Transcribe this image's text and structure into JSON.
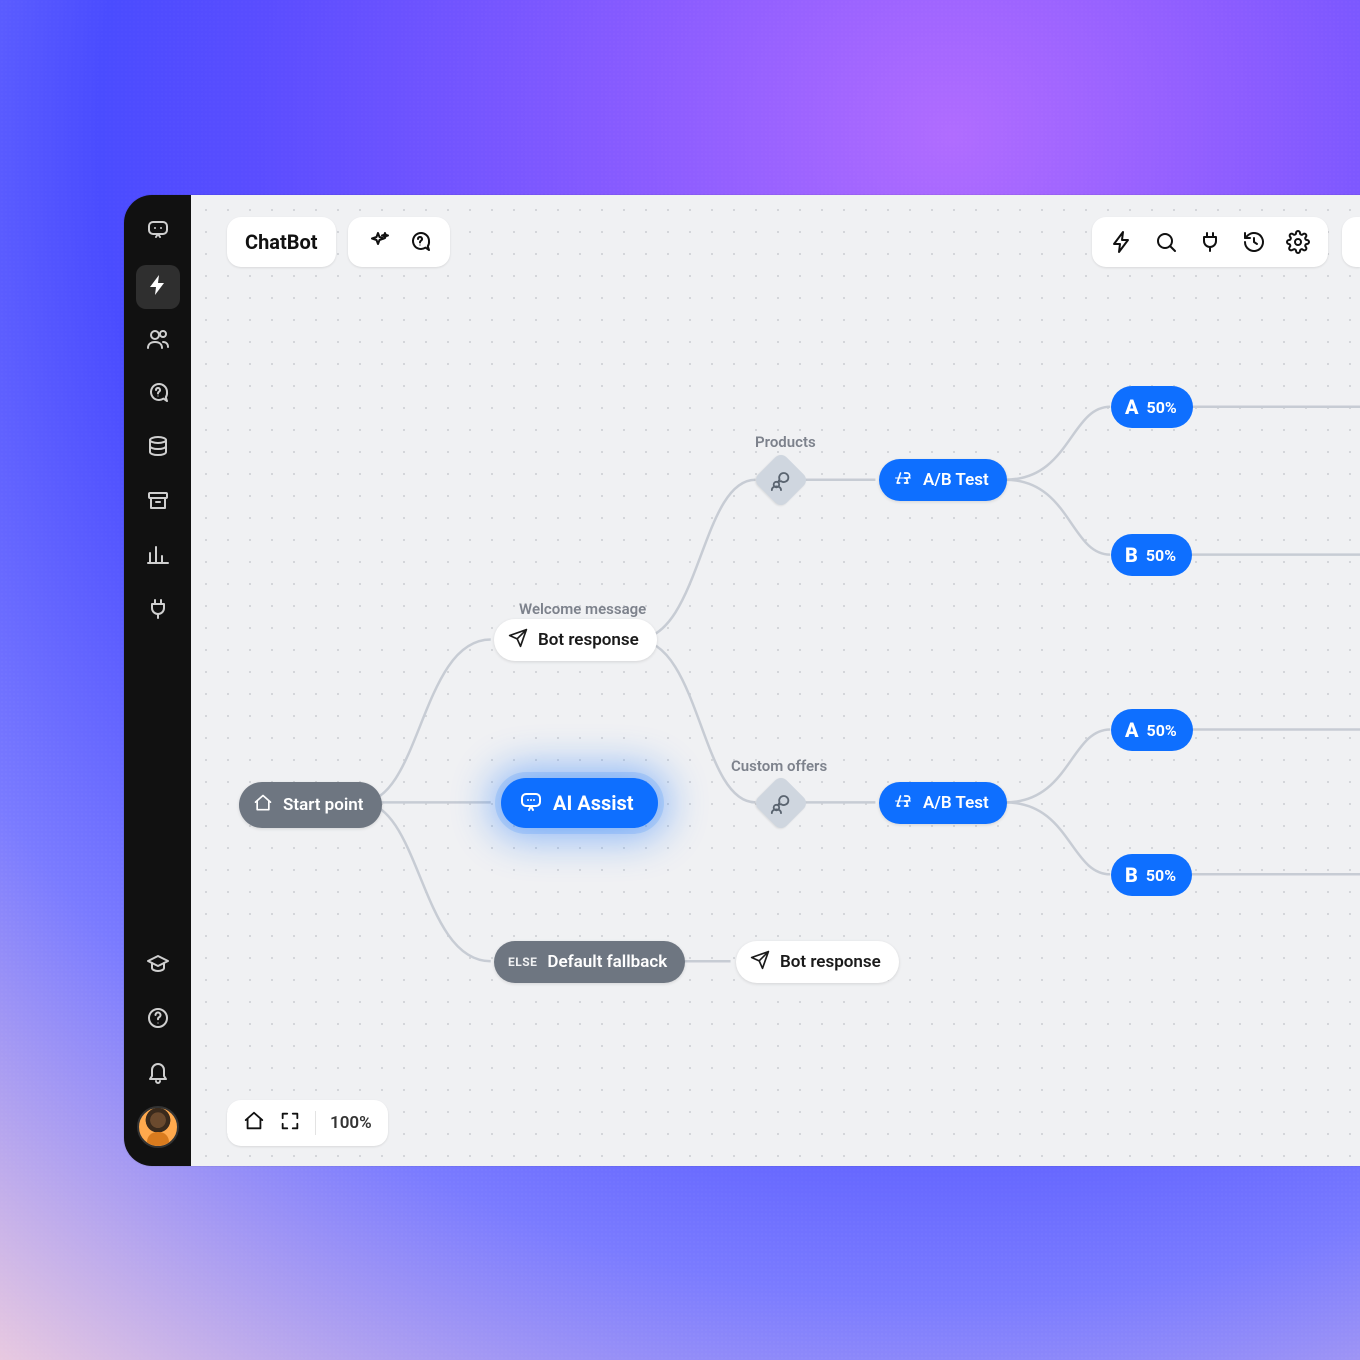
{
  "app_name": "ChatBot",
  "sidebar": {
    "icons": [
      "chat-icon",
      "bolt-icon",
      "users-icon",
      "chat-question-icon",
      "database-icon",
      "archive-icon",
      "bar-chart-icon",
      "plug-icon"
    ],
    "bottom_icons": [
      "graduation-icon",
      "help-icon",
      "bell-icon"
    ]
  },
  "zoom": {
    "level": "100%"
  },
  "nodes": {
    "start": "Start point",
    "welcome_label": "Welcome message",
    "bot_response": "Bot response",
    "ai_assist": "AI Assist",
    "default_else": "ELSE",
    "default_fallback": "Default fallback",
    "bot_response2": "Bot response",
    "products_label": "Products",
    "custom_label": "Custom offers",
    "abtest": "A/B Test",
    "variant_a": "A",
    "variant_b": "B",
    "pct": "50%"
  }
}
